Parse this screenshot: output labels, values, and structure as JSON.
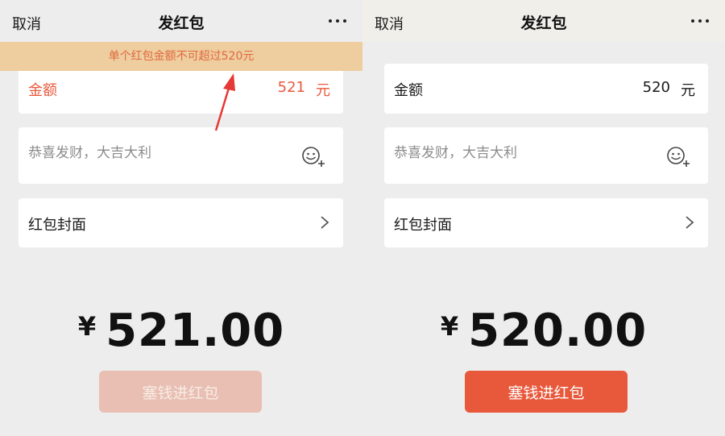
{
  "left": {
    "nav": {
      "cancel": "取消",
      "title": "发红包",
      "more_icon": "more-icon"
    },
    "banner": "单个红包金额不可超过520元",
    "amount": {
      "label": "金额",
      "value": "521",
      "unit": "元"
    },
    "greeting": {
      "placeholder": "恭喜发财，大吉大利",
      "icon": "emoji-icon"
    },
    "cover": {
      "label": "红包封面",
      "icon": "chevron-right-icon"
    },
    "total": {
      "currency": "¥",
      "value": "521.00"
    },
    "send_button": {
      "label": "塞钱进红包",
      "enabled": false
    },
    "annotation": {
      "icon": "red-arrow-annotation",
      "color": "#e53935"
    }
  },
  "right": {
    "nav": {
      "cancel": "取消",
      "title": "发红包",
      "more_icon": "more-icon"
    },
    "amount": {
      "label": "金额",
      "value": "520",
      "unit": "元"
    },
    "greeting": {
      "placeholder": "恭喜发财，大吉大利",
      "icon": "emoji-icon"
    },
    "cover": {
      "label": "红包封面",
      "icon": "chevron-right-icon"
    },
    "total": {
      "currency": "¥",
      "value": "520.00"
    },
    "send_button": {
      "label": "塞钱进红包",
      "enabled": true
    }
  },
  "colors": {
    "background": "#ededed",
    "accent_red": "#e8593c",
    "disabled_button": "#e8bfb2",
    "warning_banner_bg": "#eecd9f",
    "warning_banner_text": "#e06a3f"
  }
}
